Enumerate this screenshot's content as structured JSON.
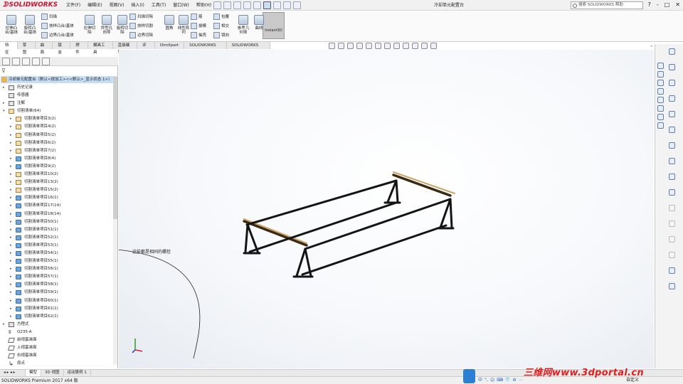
{
  "app": {
    "logo_text": "SOLIDWORKS",
    "doc_title": "冷却单元配置台",
    "search_placeholder": "搜索 SOLIDWORKS 帮助",
    "menu": [
      "文件(F)",
      "编辑(E)",
      "视图(V)",
      "插入(I)",
      "工具(T)",
      "窗口(W)",
      "帮助(H)"
    ],
    "win_controls": [
      "?",
      "-",
      "□",
      "✕"
    ]
  },
  "ribbon": {
    "large": [
      {
        "label": "拉伸凸\n台/基体",
        "icon": "extrude-boss-icon"
      },
      {
        "label": "旋转凸\n台/基体",
        "icon": "revolve-boss-icon"
      },
      {
        "label": "拉伸切\n除",
        "icon": "extrude-cut-icon"
      },
      {
        "label": "异型孔\n向导",
        "icon": "hole-wizard-icon"
      },
      {
        "label": "旋转切\n除",
        "icon": "revolve-cut-icon"
      },
      {
        "label": "圆角",
        "icon": "fillet-icon"
      },
      {
        "label": "线性阵\n列",
        "icon": "linear-pattern-icon"
      },
      {
        "label": "参考几\n何体",
        "icon": "reference-geometry-icon"
      },
      {
        "label": "曲线",
        "icon": "curves-icon"
      }
    ],
    "small": [
      {
        "label": "扫描",
        "icon": "sweep-icon"
      },
      {
        "label": "放样凸台/基体",
        "icon": "loft-icon"
      },
      {
        "label": "边界凸台/基体",
        "icon": "boundary-boss-icon"
      },
      {
        "label": "扫描切除",
        "icon": "swept-cut-icon"
      },
      {
        "label": "放样切割",
        "icon": "lofted-cut-icon"
      },
      {
        "label": "边界切除",
        "icon": "boundary-cut-icon"
      },
      {
        "label": "筋",
        "icon": "rib-icon"
      },
      {
        "label": "拔模",
        "icon": "draft-icon"
      },
      {
        "label": "抽壳",
        "icon": "shell-icon"
      },
      {
        "label": "包覆",
        "icon": "wrap-icon"
      },
      {
        "label": "相交",
        "icon": "intersect-icon"
      },
      {
        "label": "镜向",
        "icon": "mirror-icon"
      }
    ],
    "instant3d": "Instant3D"
  },
  "tabs": [
    "特征",
    "草图",
    "曲面",
    "钣金",
    "焊件",
    "模具工具",
    "直接编辑",
    "评估",
    "DimXpert",
    "SOLIDWORKS 插件",
    "SOLIDWORKS MBD"
  ],
  "tree": {
    "root": "冷却单元配置台（默认<按加工><<默认>_显示状态 1>）",
    "items": [
      {
        "label": "历史记录",
        "icon": "gen",
        "indent": 0,
        "arrow": "▸"
      },
      {
        "label": "传感器",
        "icon": "gen",
        "indent": 0,
        "arrow": ""
      },
      {
        "label": "注解",
        "icon": "gen",
        "indent": 0,
        "arrow": "▸"
      },
      {
        "label": "切割清单(64)",
        "icon": "lst",
        "indent": 0,
        "arrow": "▾"
      },
      {
        "label": "切割清单项目3(2)",
        "icon": "lst",
        "indent": 1,
        "arrow": "▸"
      },
      {
        "label": "切割清单项目4(2)",
        "icon": "lst",
        "indent": 1,
        "arrow": "▸"
      },
      {
        "label": "切割清单项目5(2)",
        "icon": "lst",
        "indent": 1,
        "arrow": "▸"
      },
      {
        "label": "切割清单项目6(2)",
        "icon": "lst",
        "indent": 1,
        "arrow": "▸"
      },
      {
        "label": "切割清单项目7(2)",
        "icon": "lst",
        "indent": 1,
        "arrow": "▸"
      },
      {
        "label": "切割清单项目8(4)",
        "icon": "folder",
        "indent": 1,
        "arrow": "▸"
      },
      {
        "label": "切割清单项目9(2)",
        "icon": "folder",
        "indent": 1,
        "arrow": "▸"
      },
      {
        "label": "切割清单项目10(2)",
        "icon": "lst",
        "indent": 1,
        "arrow": "▸"
      },
      {
        "label": "切割清单项目13(2)",
        "icon": "lst",
        "indent": 1,
        "arrow": "▸"
      },
      {
        "label": "切割清单项目15(2)",
        "icon": "lst",
        "indent": 1,
        "arrow": "▸"
      },
      {
        "label": "切割清单项目16(1)",
        "icon": "folder",
        "indent": 1,
        "arrow": "▸"
      },
      {
        "label": "切割清单项目17(14)",
        "icon": "folder",
        "indent": 1,
        "arrow": "▸"
      },
      {
        "label": "切割清单项目18(14)",
        "icon": "folder",
        "indent": 1,
        "arrow": "▸"
      },
      {
        "label": "切割清单项目50(1)",
        "icon": "folder",
        "indent": 1,
        "arrow": "▸"
      },
      {
        "label": "切割清单项目51(1)",
        "icon": "folder",
        "indent": 1,
        "arrow": "▸"
      },
      {
        "label": "切割清单项目52(1)",
        "icon": "folder",
        "indent": 1,
        "arrow": "▸"
      },
      {
        "label": "切割清单项目53(1)",
        "icon": "folder",
        "indent": 1,
        "arrow": "▸"
      },
      {
        "label": "切割清单项目54(1)",
        "icon": "folder",
        "indent": 1,
        "arrow": "▸"
      },
      {
        "label": "切割清单项目55(1)",
        "icon": "folder",
        "indent": 1,
        "arrow": "▸"
      },
      {
        "label": "切割清单项目56(1)",
        "icon": "folder",
        "indent": 1,
        "arrow": "▸"
      },
      {
        "label": "切割清单项目57(1)",
        "icon": "folder",
        "indent": 1,
        "arrow": "▸"
      },
      {
        "label": "切割清单项目58(1)",
        "icon": "folder",
        "indent": 1,
        "arrow": "▸"
      },
      {
        "label": "切割清单项目59(1)",
        "icon": "folder",
        "indent": 1,
        "arrow": "▸"
      },
      {
        "label": "切割清单项目60(1)",
        "icon": "folder",
        "indent": 1,
        "arrow": "▸"
      },
      {
        "label": "切割清单项目61(1)",
        "icon": "folder",
        "indent": 1,
        "arrow": "▸"
      },
      {
        "label": "切割清单项目62(1)",
        "icon": "folder",
        "indent": 1,
        "arrow": "▸"
      },
      {
        "label": "方程式",
        "icon": "gen",
        "indent": 0,
        "arrow": "▸"
      },
      {
        "label": "Q235-A",
        "icon": "mat",
        "indent": 0,
        "arrow": ""
      },
      {
        "label": "前视基准面",
        "icon": "plane",
        "indent": 0,
        "arrow": ""
      },
      {
        "label": "上视基准面",
        "icon": "plane",
        "indent": 0,
        "arrow": ""
      },
      {
        "label": "右视基准面",
        "icon": "plane",
        "indent": 0,
        "arrow": ""
      },
      {
        "label": "原点",
        "icon": "org",
        "indent": 0,
        "arrow": ""
      }
    ]
  },
  "annotation": "这些都是相同的螺栓",
  "bottom_tabs": [
    "模型",
    "3D 视图",
    "运动算例 1"
  ],
  "status": "SOLIDWORKS Premium 2017 x64 版",
  "status_right": "自定义",
  "ime_text": [
    "中",
    "°,",
    "☺",
    "⌨",
    "👕",
    "⚙",
    "⋯"
  ],
  "watermark": "三维网www.3dportal.cn",
  "colors": {
    "accent": "#c8102e",
    "selection": "#c6ddf5",
    "frame": "#141414",
    "wood": "#c9a266"
  }
}
